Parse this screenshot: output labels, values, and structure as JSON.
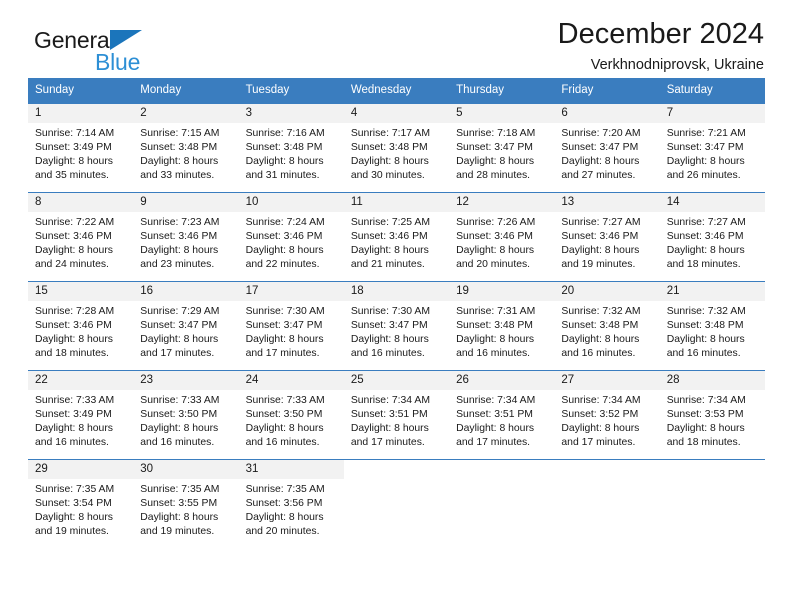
{
  "brand": {
    "name_part1": "General",
    "name_part2": "Blue",
    "triangle_icon": "triangle-icon",
    "accent_color": "#2d8fd5",
    "dark_color": "#1a1a1a"
  },
  "header": {
    "title": "December 2024",
    "subtitle": "Verkhnodniprovsk, Ukraine"
  },
  "calendar": {
    "header_bg": "#3a7dbf",
    "daynum_bg": "#f2f2f2",
    "weekdays": [
      "Sunday",
      "Monday",
      "Tuesday",
      "Wednesday",
      "Thursday",
      "Friday",
      "Saturday"
    ],
    "weeks": [
      [
        {
          "day": "1",
          "sunrise": "Sunrise: 7:14 AM",
          "sunset": "Sunset: 3:49 PM",
          "daylight1": "Daylight: 8 hours",
          "daylight2": "and 35 minutes."
        },
        {
          "day": "2",
          "sunrise": "Sunrise: 7:15 AM",
          "sunset": "Sunset: 3:48 PM",
          "daylight1": "Daylight: 8 hours",
          "daylight2": "and 33 minutes."
        },
        {
          "day": "3",
          "sunrise": "Sunrise: 7:16 AM",
          "sunset": "Sunset: 3:48 PM",
          "daylight1": "Daylight: 8 hours",
          "daylight2": "and 31 minutes."
        },
        {
          "day": "4",
          "sunrise": "Sunrise: 7:17 AM",
          "sunset": "Sunset: 3:48 PM",
          "daylight1": "Daylight: 8 hours",
          "daylight2": "and 30 minutes."
        },
        {
          "day": "5",
          "sunrise": "Sunrise: 7:18 AM",
          "sunset": "Sunset: 3:47 PM",
          "daylight1": "Daylight: 8 hours",
          "daylight2": "and 28 minutes."
        },
        {
          "day": "6",
          "sunrise": "Sunrise: 7:20 AM",
          "sunset": "Sunset: 3:47 PM",
          "daylight1": "Daylight: 8 hours",
          "daylight2": "and 27 minutes."
        },
        {
          "day": "7",
          "sunrise": "Sunrise: 7:21 AM",
          "sunset": "Sunset: 3:47 PM",
          "daylight1": "Daylight: 8 hours",
          "daylight2": "and 26 minutes."
        }
      ],
      [
        {
          "day": "8",
          "sunrise": "Sunrise: 7:22 AM",
          "sunset": "Sunset: 3:46 PM",
          "daylight1": "Daylight: 8 hours",
          "daylight2": "and 24 minutes."
        },
        {
          "day": "9",
          "sunrise": "Sunrise: 7:23 AM",
          "sunset": "Sunset: 3:46 PM",
          "daylight1": "Daylight: 8 hours",
          "daylight2": "and 23 minutes."
        },
        {
          "day": "10",
          "sunrise": "Sunrise: 7:24 AM",
          "sunset": "Sunset: 3:46 PM",
          "daylight1": "Daylight: 8 hours",
          "daylight2": "and 22 minutes."
        },
        {
          "day": "11",
          "sunrise": "Sunrise: 7:25 AM",
          "sunset": "Sunset: 3:46 PM",
          "daylight1": "Daylight: 8 hours",
          "daylight2": "and 21 minutes."
        },
        {
          "day": "12",
          "sunrise": "Sunrise: 7:26 AM",
          "sunset": "Sunset: 3:46 PM",
          "daylight1": "Daylight: 8 hours",
          "daylight2": "and 20 minutes."
        },
        {
          "day": "13",
          "sunrise": "Sunrise: 7:27 AM",
          "sunset": "Sunset: 3:46 PM",
          "daylight1": "Daylight: 8 hours",
          "daylight2": "and 19 minutes."
        },
        {
          "day": "14",
          "sunrise": "Sunrise: 7:27 AM",
          "sunset": "Sunset: 3:46 PM",
          "daylight1": "Daylight: 8 hours",
          "daylight2": "and 18 minutes."
        }
      ],
      [
        {
          "day": "15",
          "sunrise": "Sunrise: 7:28 AM",
          "sunset": "Sunset: 3:46 PM",
          "daylight1": "Daylight: 8 hours",
          "daylight2": "and 18 minutes."
        },
        {
          "day": "16",
          "sunrise": "Sunrise: 7:29 AM",
          "sunset": "Sunset: 3:47 PM",
          "daylight1": "Daylight: 8 hours",
          "daylight2": "and 17 minutes."
        },
        {
          "day": "17",
          "sunrise": "Sunrise: 7:30 AM",
          "sunset": "Sunset: 3:47 PM",
          "daylight1": "Daylight: 8 hours",
          "daylight2": "and 17 minutes."
        },
        {
          "day": "18",
          "sunrise": "Sunrise: 7:30 AM",
          "sunset": "Sunset: 3:47 PM",
          "daylight1": "Daylight: 8 hours",
          "daylight2": "and 16 minutes."
        },
        {
          "day": "19",
          "sunrise": "Sunrise: 7:31 AM",
          "sunset": "Sunset: 3:48 PM",
          "daylight1": "Daylight: 8 hours",
          "daylight2": "and 16 minutes."
        },
        {
          "day": "20",
          "sunrise": "Sunrise: 7:32 AM",
          "sunset": "Sunset: 3:48 PM",
          "daylight1": "Daylight: 8 hours",
          "daylight2": "and 16 minutes."
        },
        {
          "day": "21",
          "sunrise": "Sunrise: 7:32 AM",
          "sunset": "Sunset: 3:48 PM",
          "daylight1": "Daylight: 8 hours",
          "daylight2": "and 16 minutes."
        }
      ],
      [
        {
          "day": "22",
          "sunrise": "Sunrise: 7:33 AM",
          "sunset": "Sunset: 3:49 PM",
          "daylight1": "Daylight: 8 hours",
          "daylight2": "and 16 minutes."
        },
        {
          "day": "23",
          "sunrise": "Sunrise: 7:33 AM",
          "sunset": "Sunset: 3:50 PM",
          "daylight1": "Daylight: 8 hours",
          "daylight2": "and 16 minutes."
        },
        {
          "day": "24",
          "sunrise": "Sunrise: 7:33 AM",
          "sunset": "Sunset: 3:50 PM",
          "daylight1": "Daylight: 8 hours",
          "daylight2": "and 16 minutes."
        },
        {
          "day": "25",
          "sunrise": "Sunrise: 7:34 AM",
          "sunset": "Sunset: 3:51 PM",
          "daylight1": "Daylight: 8 hours",
          "daylight2": "and 17 minutes."
        },
        {
          "day": "26",
          "sunrise": "Sunrise: 7:34 AM",
          "sunset": "Sunset: 3:51 PM",
          "daylight1": "Daylight: 8 hours",
          "daylight2": "and 17 minutes."
        },
        {
          "day": "27",
          "sunrise": "Sunrise: 7:34 AM",
          "sunset": "Sunset: 3:52 PM",
          "daylight1": "Daylight: 8 hours",
          "daylight2": "and 17 minutes."
        },
        {
          "day": "28",
          "sunrise": "Sunrise: 7:34 AM",
          "sunset": "Sunset: 3:53 PM",
          "daylight1": "Daylight: 8 hours",
          "daylight2": "and 18 minutes."
        }
      ],
      [
        {
          "day": "29",
          "sunrise": "Sunrise: 7:35 AM",
          "sunset": "Sunset: 3:54 PM",
          "daylight1": "Daylight: 8 hours",
          "daylight2": "and 19 minutes."
        },
        {
          "day": "30",
          "sunrise": "Sunrise: 7:35 AM",
          "sunset": "Sunset: 3:55 PM",
          "daylight1": "Daylight: 8 hours",
          "daylight2": "and 19 minutes."
        },
        {
          "day": "31",
          "sunrise": "Sunrise: 7:35 AM",
          "sunset": "Sunset: 3:56 PM",
          "daylight1": "Daylight: 8 hours",
          "daylight2": "and 20 minutes."
        },
        {
          "day": "",
          "sunrise": "",
          "sunset": "",
          "daylight1": "",
          "daylight2": ""
        },
        {
          "day": "",
          "sunrise": "",
          "sunset": "",
          "daylight1": "",
          "daylight2": ""
        },
        {
          "day": "",
          "sunrise": "",
          "sunset": "",
          "daylight1": "",
          "daylight2": ""
        },
        {
          "day": "",
          "sunrise": "",
          "sunset": "",
          "daylight1": "",
          "daylight2": ""
        }
      ]
    ]
  }
}
